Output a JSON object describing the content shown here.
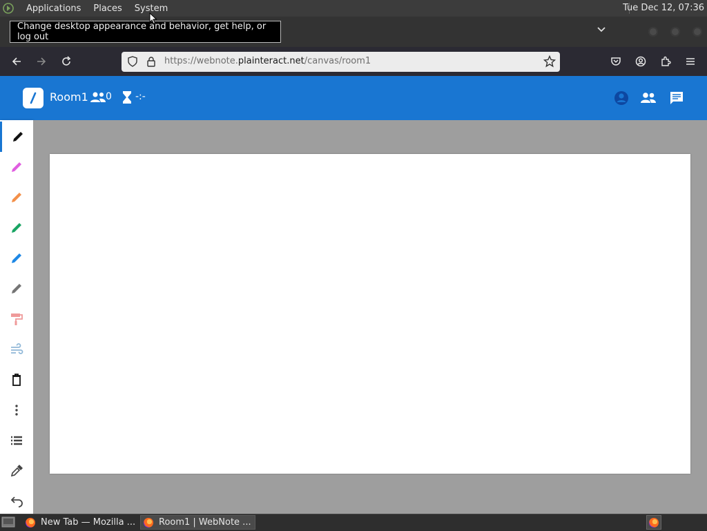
{
  "top_panel": {
    "menus": [
      "Applications",
      "Places",
      "System"
    ],
    "clock": "Tue Dec 12, 07:36"
  },
  "tooltip": "Change desktop appearance and behavior, get help, or log out",
  "browser": {
    "url_prefix": "https://webnote.",
    "url_domain": "plainteract.net",
    "url_path": "/canvas/room1"
  },
  "app": {
    "room_name": "Room1",
    "participants_count": "0",
    "timer": "-:-",
    "accent_color": "#1976d2"
  },
  "toolbar": {
    "tools": [
      {
        "name": "pen-black",
        "color": "#111111"
      },
      {
        "name": "pen-magenta",
        "color": "#e05ee0"
      },
      {
        "name": "pen-orange",
        "color": "#f3904a"
      },
      {
        "name": "pen-green",
        "color": "#19a463"
      },
      {
        "name": "pen-blue",
        "color": "#1e88e5"
      },
      {
        "name": "pen-gray",
        "color": "#757575"
      },
      {
        "name": "paint-roller",
        "color": "#ef9a9a"
      },
      {
        "name": "wind",
        "color": "#90b8d8"
      },
      {
        "name": "delete",
        "color": "#111111"
      },
      {
        "name": "more",
        "color": "#444444"
      },
      {
        "name": "list",
        "color": "#444444"
      },
      {
        "name": "eyedropper",
        "color": "#444444"
      },
      {
        "name": "undo",
        "color": "#444444"
      }
    ]
  },
  "taskbar": {
    "tasks": [
      "New Tab — Mozilla ...",
      "Room1 | WebNote ..."
    ]
  }
}
